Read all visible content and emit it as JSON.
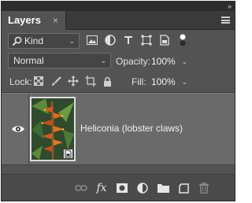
{
  "panel": {
    "title": "Layers",
    "close_glyph": "×",
    "collapse_glyph": "»",
    "menu_icon": "hamburger-menu-icon"
  },
  "filter": {
    "kind_label": "Kind",
    "icons": [
      "pixel-layer-filter-icon",
      "adjustment-layer-filter-icon",
      "type-layer-filter-icon",
      "shape-layer-filter-icon",
      "smart-object-filter-icon",
      "filter-toggle-icon"
    ]
  },
  "blending": {
    "mode": "Normal",
    "opacity_label": "Opacity:",
    "opacity_value": "100%"
  },
  "lock": {
    "label": "Lock:",
    "icons": [
      "lock-transparent-pixels-icon",
      "lock-image-pixels-icon",
      "lock-position-icon",
      "lock-artboard-icon",
      "lock-all-icon"
    ],
    "fill_label": "Fill:",
    "fill_value": "100%"
  },
  "layers": [
    {
      "name": "Heliconia (lobster claws)",
      "visible": true,
      "type": "smart-object"
    }
  ],
  "footer": {
    "fx_label": "fx",
    "icons": [
      "link-layers-icon",
      "layer-style-icon",
      "add-mask-icon",
      "new-adjustment-layer-icon",
      "new-group-icon",
      "new-layer-icon",
      "delete-layer-icon"
    ]
  },
  "colors": {
    "panel_bg": "#535353",
    "selected_row": "#6a6a6a",
    "text": "#e6e6e6"
  }
}
